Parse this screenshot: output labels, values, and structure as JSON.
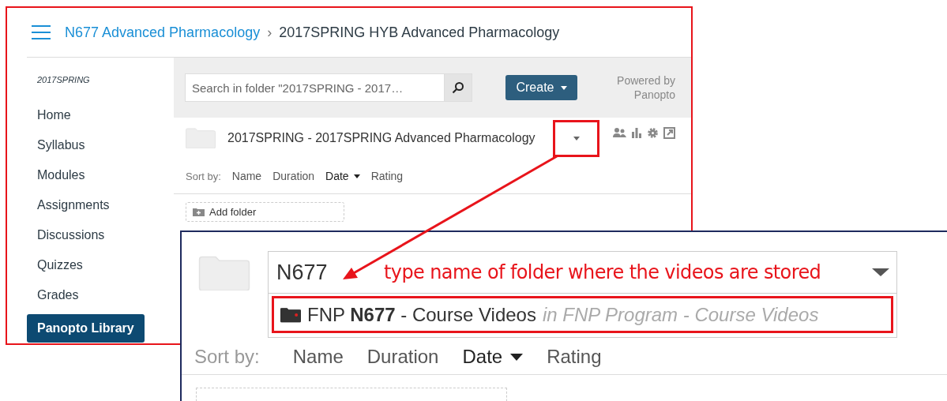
{
  "breadcrumb": {
    "link": "N677 Advanced Pharmacology",
    "separator": "›",
    "current": "2017SPRING HYB Advanced Pharmacology"
  },
  "sidebar": {
    "term": "2017SPRING",
    "items": [
      {
        "label": "Home",
        "selected": false
      },
      {
        "label": "Syllabus",
        "selected": false
      },
      {
        "label": "Modules",
        "selected": false
      },
      {
        "label": "Assignments",
        "selected": false
      },
      {
        "label": "Discussions",
        "selected": false
      },
      {
        "label": "Quizzes",
        "selected": false
      },
      {
        "label": "Grades",
        "selected": false
      },
      {
        "label": "Panopto Library",
        "selected": true
      }
    ]
  },
  "toolbar": {
    "search": {
      "placeholder": "Search in folder \"2017SPRING - 2017…"
    },
    "create_button": "Create",
    "powered_by": [
      "Powered by",
      "Panopto"
    ]
  },
  "folder": {
    "title": "2017SPRING - 2017SPRING Advanced Pharmacology"
  },
  "sort": {
    "label": "Sort by:",
    "options": [
      {
        "label": "Name",
        "selected": false
      },
      {
        "label": "Duration",
        "selected": false
      },
      {
        "label": "Date",
        "selected": true
      },
      {
        "label": "Rating",
        "selected": false
      }
    ]
  },
  "add_folder": "Add folder",
  "zoom_panel": {
    "search": {
      "value": "N677"
    },
    "suggestion": {
      "text": "FNP **N677** - Course Videos",
      "location": "in FNP Program - Course Videos"
    },
    "sort": {
      "label": "Sort by:",
      "options": [
        {
          "label": "Name",
          "selected": false
        },
        {
          "label": "Duration",
          "selected": false
        },
        {
          "label": "Date",
          "selected": true
        },
        {
          "label": "Rating",
          "selected": false
        }
      ]
    }
  },
  "annotation": {
    "text": "type name of folder where the videos are stored"
  }
}
